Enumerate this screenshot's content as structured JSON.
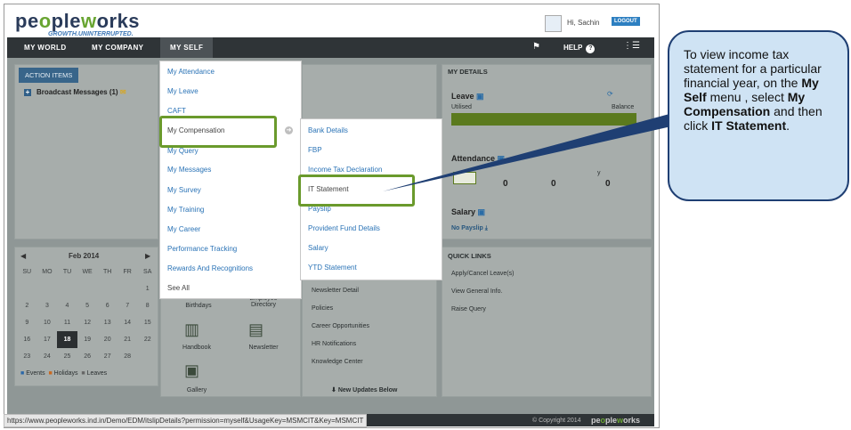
{
  "header": {
    "logo_text": "peopleworks",
    "tagline": "GROWTH.UNINTERRUPTED.",
    "greeting": "Hi, Sachin",
    "logout_label": "LOGOUT"
  },
  "topnav": {
    "items": [
      "MY WORLD",
      "MY COMPANY",
      "MY SELF"
    ],
    "help_label": "HELP"
  },
  "left_panel": {
    "tab": "ACTION ITEMS",
    "broadcast": "Broadcast Messages (1)"
  },
  "myself_menu": [
    "My Attendance",
    "My Leave",
    "CAFT",
    "My Compensation",
    "My Query",
    "My Messages",
    "My Survey",
    "My Training",
    "My Career",
    "Performance Tracking",
    "Rewards And Recognitions",
    "See All"
  ],
  "compensation_submenu": [
    "Bank Details",
    "FBP",
    "Income Tax Declaration",
    "IT Statement",
    "Payslip",
    "Provident Fund Details",
    "Salary",
    "YTD Statement"
  ],
  "my_details": {
    "title": "MY DETAILS",
    "leave": "Leave",
    "utilised": "Utilised",
    "balance": "Balance",
    "attendance": "Attendance",
    "attendance_values": [
      "0",
      "0",
      "0"
    ],
    "attendance_col_partial": "y",
    "salary": "Salary",
    "no_payslip": "No Payslip"
  },
  "quick_links": {
    "title": "QUICK LINKS",
    "items": [
      "Apply/Cancel Leave(s)",
      "View General Info.",
      "Raise Query"
    ]
  },
  "calendar": {
    "month": "Feb 2014",
    "weekdays": [
      "SU",
      "MO",
      "TU",
      "WE",
      "TH",
      "FR",
      "SA"
    ],
    "rows": [
      [
        "",
        "",
        "",
        "",
        "",
        "",
        "1"
      ],
      [
        "2",
        "3",
        "4",
        "5",
        "6",
        "7",
        "8"
      ],
      [
        "9",
        "10",
        "11",
        "12",
        "13",
        "14",
        "15"
      ],
      [
        "16",
        "17",
        "18",
        "19",
        "20",
        "21",
        "22"
      ],
      [
        "23",
        "24",
        "25",
        "26",
        "27",
        "28",
        ""
      ]
    ],
    "legend": [
      "Events",
      "Holidays",
      "Leaves"
    ]
  },
  "middle_panel": {
    "icons": [
      "Birthdays",
      "Employee Directory",
      "Handbook",
      "Newsletter",
      "Gallery"
    ],
    "links": [
      "Newsletter Detail",
      "Policies",
      "Career Opportunities",
      "HR Notifications",
      "Knowledge Center"
    ],
    "new_updates": "New Updates Below"
  },
  "callout": {
    "text_1": "To view income tax statement for a particular financial year, on the ",
    "bold_1": "My  Self",
    "text_2": " menu , select ",
    "bold_2": "My Compensation",
    "text_3": " and then click ",
    "bold_3": " IT Statement",
    "text_4": "."
  },
  "status_url": "https://www.peopleworks.ind.in/Demo/EDM/itslipDetails?permission=myself&UsageKey=MSMCIT&Key=MSMCIT",
  "footer": {
    "copyright": "© Copyright 2014",
    "logo": "peopleworks"
  }
}
